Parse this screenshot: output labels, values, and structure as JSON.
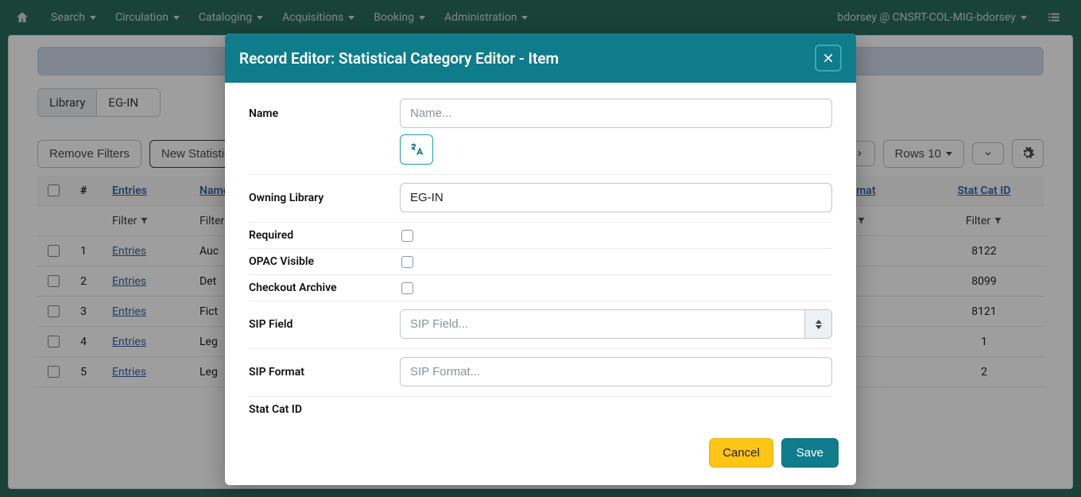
{
  "topnav": {
    "items": [
      "Search",
      "Circulation",
      "Cataloging",
      "Acquisitions",
      "Booking",
      "Administration"
    ],
    "user_context": "bdorsey @ CNSRT-COL-MIG-bdorsey"
  },
  "library_selector": {
    "label": "Library",
    "value": "EG-IN"
  },
  "toolbar": {
    "remove_filters": "Remove Filters",
    "new_stat_cat": "New Statistical Category",
    "rows_label": "Rows 10"
  },
  "grid": {
    "headers": {
      "num": "#",
      "entries": "Entries",
      "name": "Name",
      "format": "ormat",
      "id": "Stat Cat ID"
    },
    "filter_label": "Filter",
    "rows": [
      {
        "num": "1",
        "entries": "Entries",
        "name": "Auc",
        "id": "8122"
      },
      {
        "num": "2",
        "entries": "Entries",
        "name": "Det",
        "id": "8099"
      },
      {
        "num": "3",
        "entries": "Entries",
        "name": "Fict",
        "id": "8121"
      },
      {
        "num": "4",
        "entries": "Entries",
        "name": "Leg",
        "id": "1"
      },
      {
        "num": "5",
        "entries": "Entries",
        "name": "Leg",
        "id": "2"
      }
    ]
  },
  "modal": {
    "title": "Record Editor: Statistical Category Editor - Item",
    "fields": {
      "name_label": "Name",
      "name_placeholder": "Name...",
      "owning_label": "Owning Library",
      "owning_value": "EG-IN",
      "required_label": "Required",
      "opac_label": "OPAC Visible",
      "checkout_label": "Checkout Archive",
      "sipfield_label": "SIP Field",
      "sipfield_placeholder": "SIP Field...",
      "sipformat_label": "SIP Format",
      "sipformat_placeholder": "SIP Format...",
      "id_label": "Stat Cat ID"
    },
    "buttons": {
      "cancel": "Cancel",
      "save": "Save"
    }
  }
}
